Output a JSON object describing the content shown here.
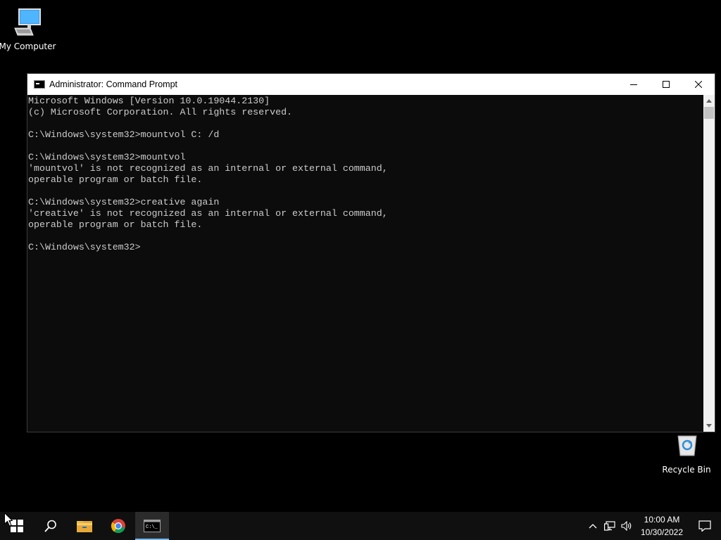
{
  "desktop": {
    "icons": [
      {
        "label": "My Computer",
        "icon": "computer-icon"
      },
      {
        "label": "Recycle Bin",
        "icon": "recycle-bin-icon"
      }
    ]
  },
  "window": {
    "title": "Administrator: Command Prompt",
    "icon": "cmd-icon",
    "controls": [
      "minimize-icon",
      "maximize-icon",
      "close-icon"
    ]
  },
  "console": {
    "lines": [
      "Microsoft Windows [Version 10.0.19044.2130]",
      "(c) Microsoft Corporation. All rights reserved.",
      "",
      "C:\\Windows\\system32>mountvol C: /d",
      "",
      "C:\\Windows\\system32>mountvol",
      "'mountvol' is not recognized as an internal or external command,",
      "operable program or batch file.",
      "",
      "C:\\Windows\\system32>creative again",
      "'creative' is not recognized as an internal or external command,",
      "operable program or batch file.",
      "",
      "C:\\Windows\\system32>"
    ],
    "colors": {
      "background": "#0c0c0c",
      "text": "#cccccc"
    }
  },
  "taskbar": {
    "apps": [
      {
        "name": "start",
        "icon": "windows-logo-icon"
      },
      {
        "name": "search",
        "icon": "search-icon"
      },
      {
        "name": "file-explorer",
        "icon": "folder-icon"
      },
      {
        "name": "chrome",
        "icon": "chrome-icon"
      },
      {
        "name": "command-prompt",
        "icon": "cmd-icon",
        "active": true
      }
    ],
    "tray": {
      "icons": [
        "chevron-up-icon",
        "network-icon",
        "volume-icon"
      ],
      "time": "10:00 AM",
      "date": "10/30/2022"
    },
    "accent": "#76b9ed"
  }
}
